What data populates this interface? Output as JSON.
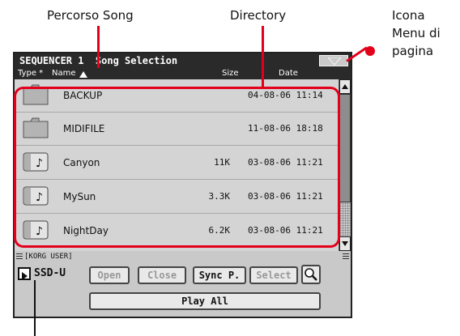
{
  "callouts": {
    "song_path": "Percorso Song",
    "directory": "Directory",
    "page_menu_icon_line1": "Icona",
    "page_menu_icon_line2": "Menu di",
    "page_menu_icon_line3": "pagina"
  },
  "window": {
    "title": "SEQUENCER 1  Song Selection"
  },
  "columns": {
    "type": "Type *",
    "name": "Name",
    "size": "Size",
    "date": "Date"
  },
  "files": [
    {
      "icon": "folder-icon",
      "name": "BACKUP",
      "size": "",
      "date": "04-08-06 11:14"
    },
    {
      "icon": "folder-icon",
      "name": "MIDIFILE",
      "size": "",
      "date": "11-08-06 18:18"
    },
    {
      "icon": "song-file-icon",
      "name": "Canyon",
      "size": "11K",
      "date": "03-08-06 11:21"
    },
    {
      "icon": "song-file-icon",
      "name": "MySun",
      "size": "3.3K",
      "date": "03-08-06 11:21"
    },
    {
      "icon": "song-file-icon",
      "name": "NightDay",
      "size": "6.2K",
      "date": "03-08-06 11:21"
    }
  ],
  "path": "[KORG USER]",
  "device": "SSD-U",
  "buttons": {
    "open": "Open",
    "close": "Close",
    "sync": "Sync P.",
    "select": "Select",
    "play_all": "Play All"
  },
  "colors": {
    "callout_red": "#e3001b",
    "title_bar": "#2a2a2a",
    "panel_bg": "#c9c9c9"
  }
}
